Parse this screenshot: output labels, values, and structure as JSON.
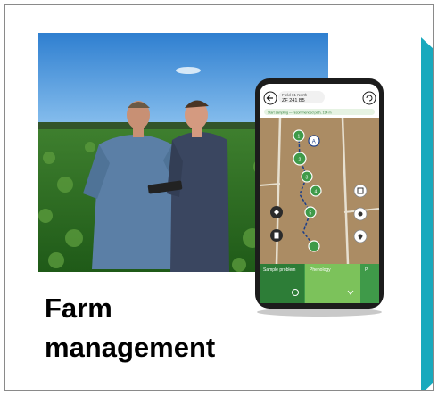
{
  "card": {
    "title_line1": "Farm",
    "title_line2": "management"
  },
  "phone": {
    "header_top": "Field 01 North",
    "header_field": "ZF 241 B5",
    "banner": "Start sampling — recommended path, 134 m",
    "point_labels": [
      "A",
      "1",
      "2",
      "3",
      "4",
      "5"
    ],
    "tab_sample_problem": "Sample problem",
    "tab_phenology": "Phenology",
    "tab_more": "P"
  },
  "colors": {
    "border": "#8a8a8a",
    "teal_accent": "#18a9bd",
    "app_green": "#3f9a49",
    "app_green_dark": "#2d7d37",
    "sky": "#3f8fd6",
    "crop": "#2c6e22"
  }
}
